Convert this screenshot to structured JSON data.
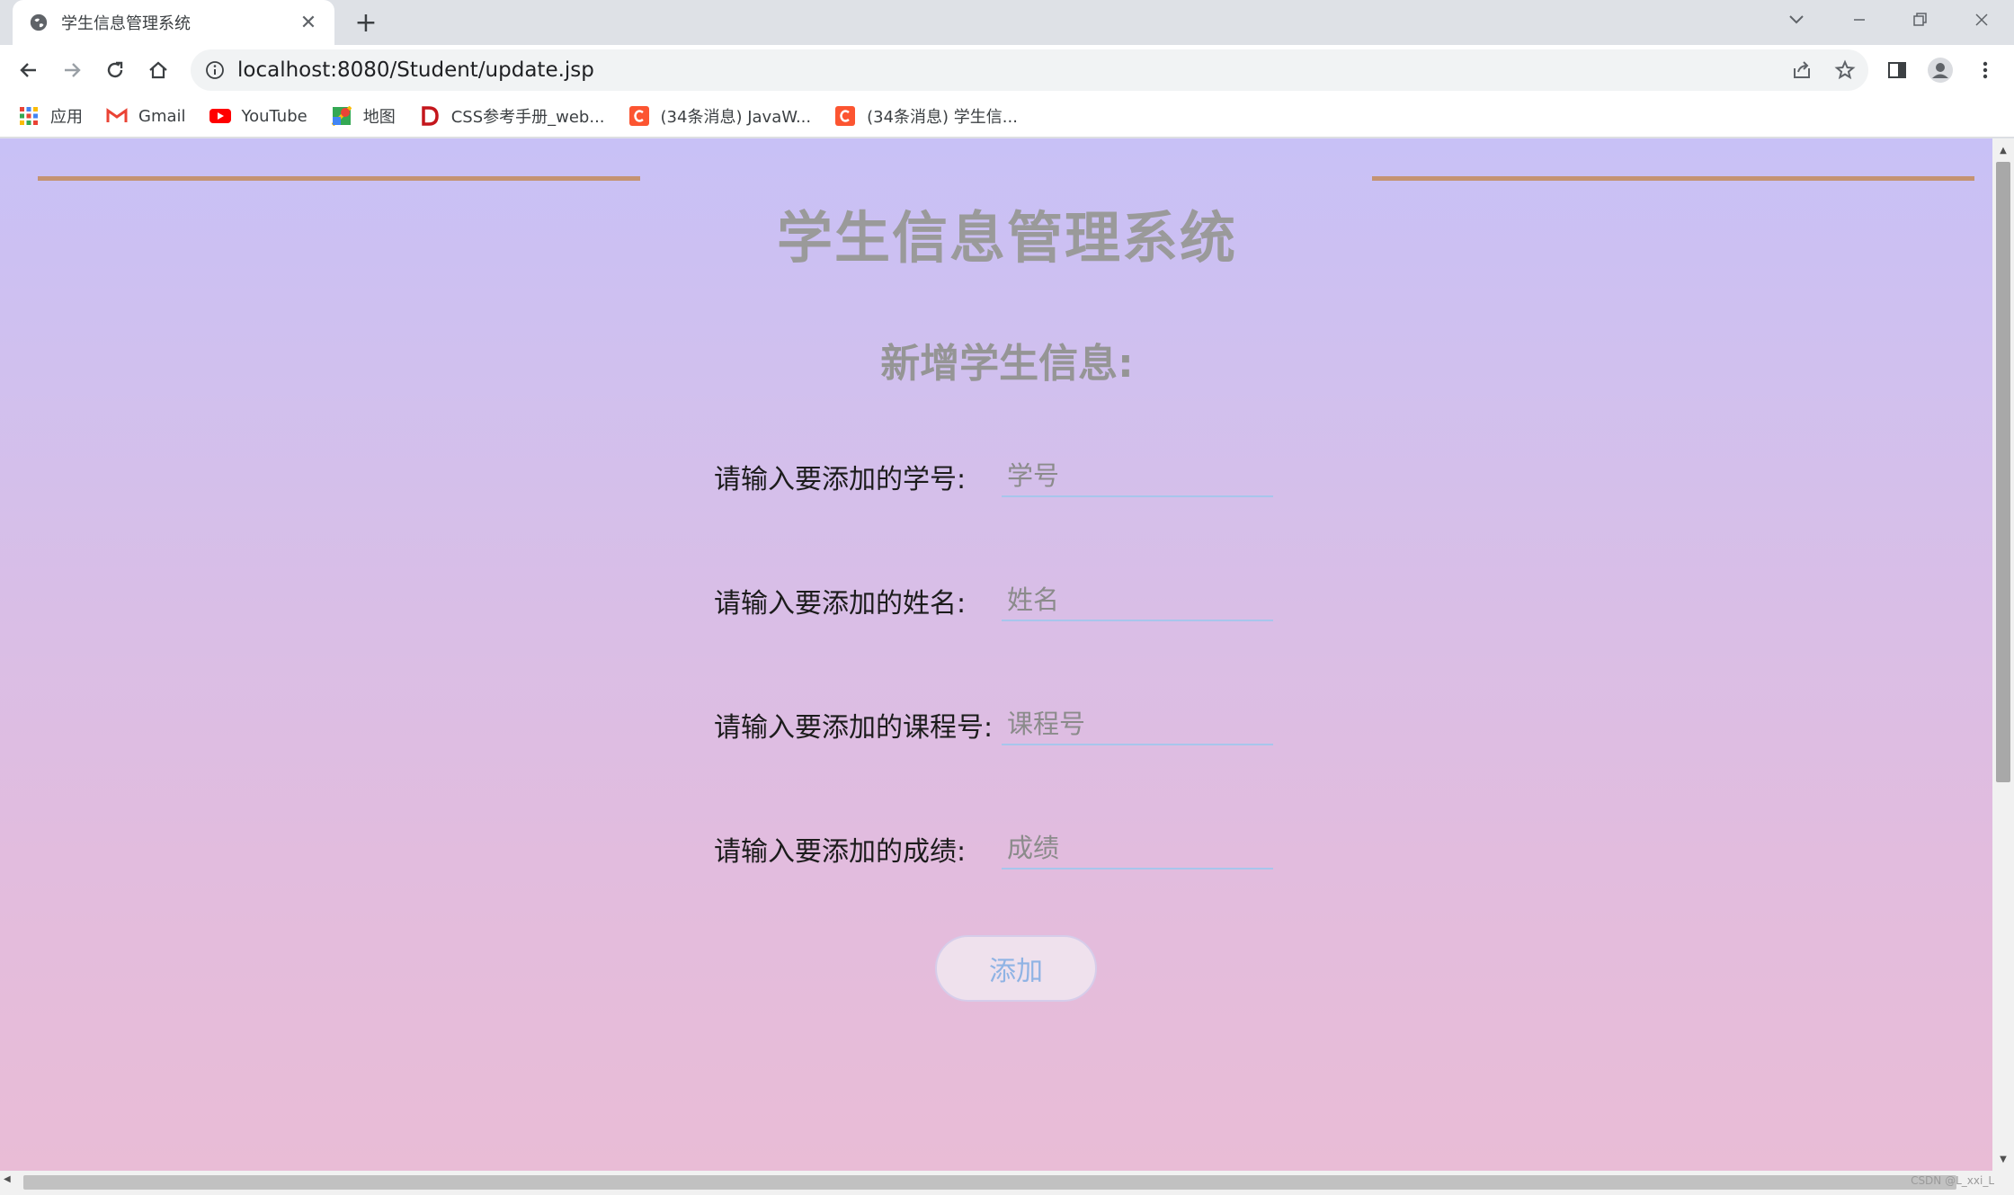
{
  "browser": {
    "tab_title": "学生信息管理系统",
    "url": "localhost:8080/Student/update.jsp",
    "bookmarks": [
      {
        "label": "应用",
        "icon": "apps-grid-icon"
      },
      {
        "label": "Gmail",
        "icon": "gmail-icon"
      },
      {
        "label": "YouTube",
        "icon": "youtube-icon"
      },
      {
        "label": "地图",
        "icon": "maps-icon"
      },
      {
        "label": "CSS参考手册_web...",
        "icon": "css-reference-icon"
      },
      {
        "label": "(34条消息) JavaW...",
        "icon": "csdn-icon"
      },
      {
        "label": "(34条消息) 学生信...",
        "icon": "csdn-icon"
      }
    ]
  },
  "page": {
    "title": "学生信息管理系统",
    "subtitle": "新增学生信息:",
    "fields": [
      {
        "label": "请输入要添加的学号:",
        "placeholder": "学号"
      },
      {
        "label": "请输入要添加的姓名:",
        "placeholder": "姓名"
      },
      {
        "label": "请输入要添加的课程号:",
        "placeholder": "课程号"
      },
      {
        "label": "请输入要添加的成绩:",
        "placeholder": "成绩"
      }
    ],
    "submit_label": "添加"
  },
  "watermark": "CSDN @L_xxi_L",
  "colors": {
    "rule": "#c49372",
    "gradient_top": "#c8c1f6",
    "gradient_bottom": "#e9bcd6",
    "input_underline": "#a7c6ec",
    "button_text": "#8fb3e4"
  }
}
